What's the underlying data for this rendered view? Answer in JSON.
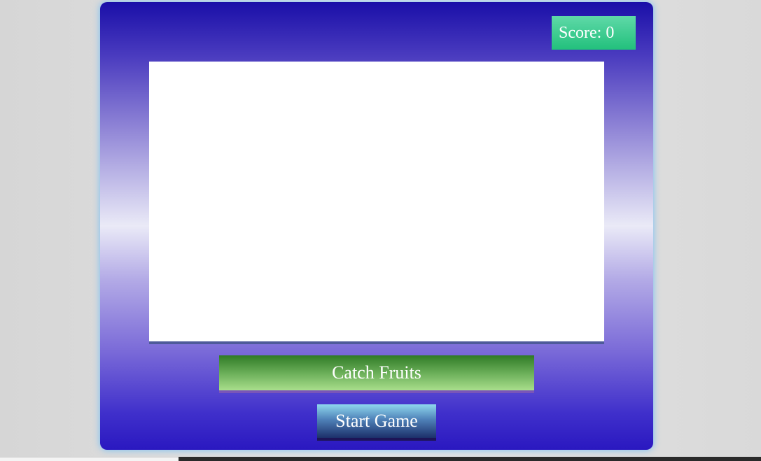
{
  "score": {
    "text": "Score: 0"
  },
  "game": {
    "title": "Catch Fruits",
    "start_label": "Start Game"
  }
}
